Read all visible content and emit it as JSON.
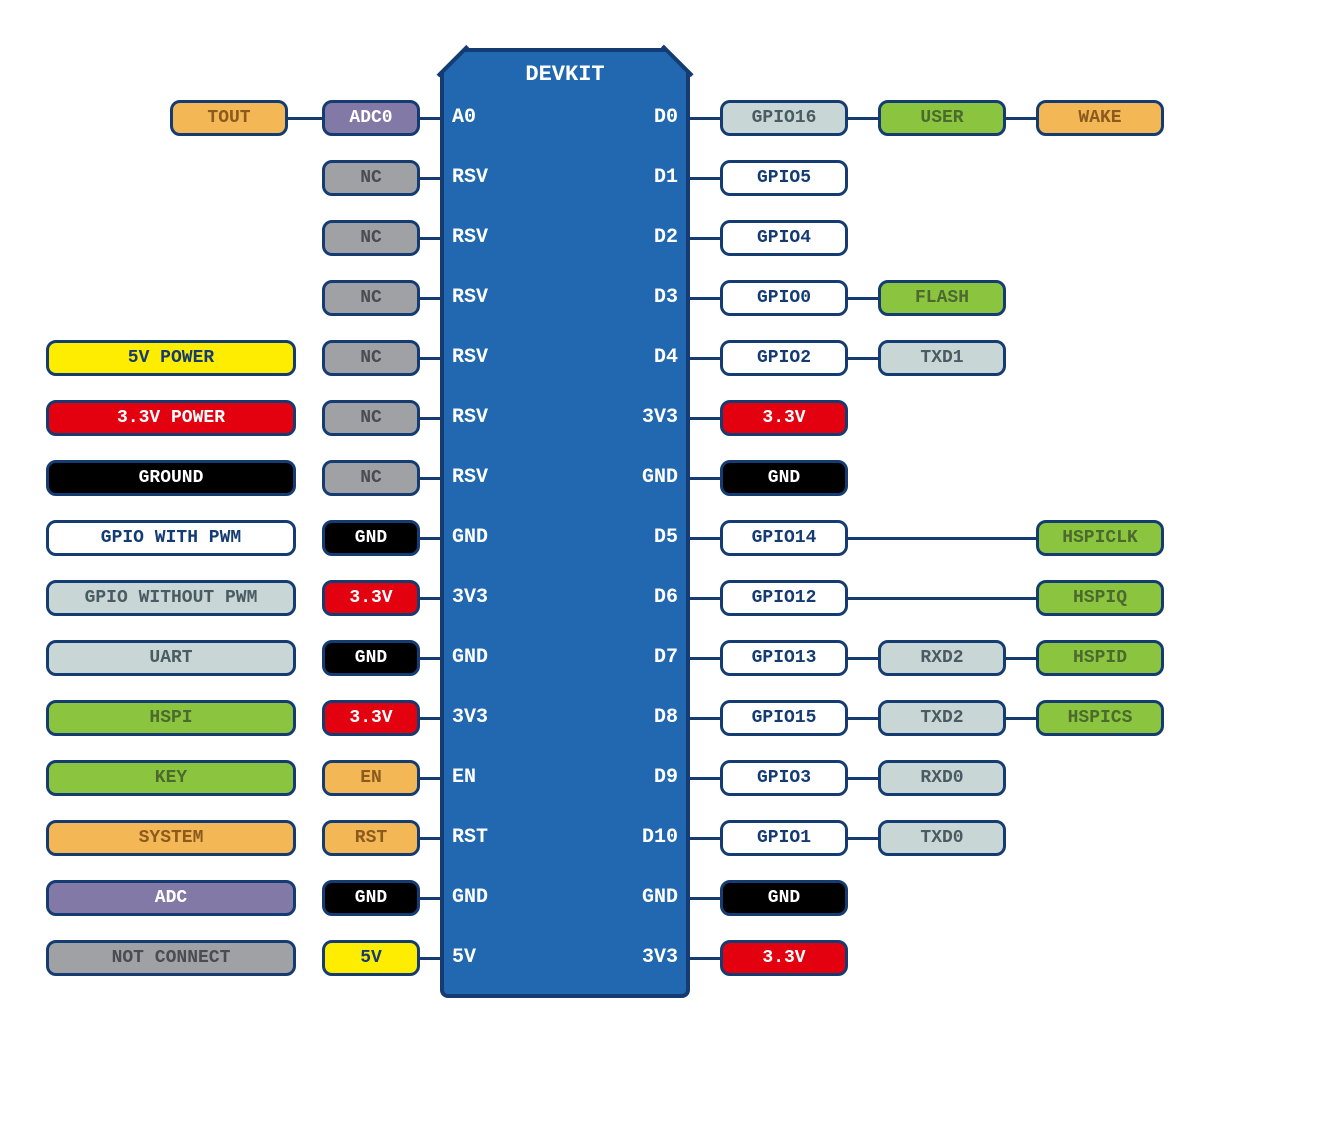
{
  "title": "DEVKIT",
  "colors": {
    "border": "#153c72",
    "module": "#2168b0",
    "pwr5v_bg": "#ffed00",
    "pwr5v_fg": "#153c72",
    "pwr3v3_bg": "#e3000f",
    "pwr3v3_fg": "#ffffff",
    "gnd_bg": "#000000",
    "gnd_fg": "#ffffff",
    "gpio_pwm_bg": "#ffffff",
    "gpio_pwm_fg": "#153c72",
    "gpio_nopwm_bg": "#c8d7d5",
    "gpio_nopwm_fg": "#4a5b63",
    "uart_bg": "#c8d7d5",
    "uart_fg": "#4a5b63",
    "hspi_bg": "#8bc53f",
    "hspi_fg": "#4c6a2e",
    "key_bg": "#8bc53f",
    "key_fg": "#4c6a2e",
    "system_bg": "#f4b755",
    "system_fg": "#8a5a1e",
    "adc_bg": "#8279a6",
    "adc_fg": "#ffffff",
    "nc_bg": "#9fa1a4",
    "nc_fg": "#4a4c51"
  },
  "legend": [
    {
      "label": "5V POWER",
      "kind": "pwr5v"
    },
    {
      "label": "3.3V POWER",
      "kind": "pwr3v3"
    },
    {
      "label": "GROUND",
      "kind": "gnd"
    },
    {
      "label": "GPIO WITH PWM",
      "kind": "gpio_pwm"
    },
    {
      "label": "GPIO WITHOUT PWM",
      "kind": "gpio_nopwm"
    },
    {
      "label": "UART",
      "kind": "uart"
    },
    {
      "label": "HSPI",
      "kind": "hspi"
    },
    {
      "label": "KEY",
      "kind": "key"
    },
    {
      "label": "SYSTEM",
      "kind": "system"
    },
    {
      "label": "ADC",
      "kind": "adc"
    },
    {
      "label": "NOT CONNECT",
      "kind": "nc"
    }
  ],
  "left_pins": [
    "A0",
    "RSV",
    "RSV",
    "RSV",
    "RSV",
    "RSV",
    "RSV",
    "GND",
    "3V3",
    "GND",
    "3V3",
    "EN",
    "RST",
    "GND",
    "5V"
  ],
  "right_pins": [
    "D0",
    "D1",
    "D2",
    "D3",
    "D4",
    "3V3",
    "GND",
    "D5",
    "D6",
    "D7",
    "D8",
    "D9",
    "D10",
    "GND",
    "3V3"
  ],
  "left_rows": [
    [
      null,
      {
        "label": "TOUT",
        "kind": "system"
      },
      {
        "label": "ADC0",
        "kind": "adc"
      }
    ],
    [
      null,
      null,
      {
        "label": "NC",
        "kind": "nc"
      }
    ],
    [
      null,
      null,
      {
        "label": "NC",
        "kind": "nc"
      }
    ],
    [
      null,
      null,
      {
        "label": "NC",
        "kind": "nc"
      }
    ],
    [
      null,
      null,
      {
        "label": "NC",
        "kind": "nc"
      }
    ],
    [
      null,
      null,
      {
        "label": "NC",
        "kind": "nc"
      }
    ],
    [
      null,
      null,
      {
        "label": "NC",
        "kind": "nc"
      }
    ],
    [
      null,
      null,
      {
        "label": "GND",
        "kind": "gnd"
      }
    ],
    [
      null,
      null,
      {
        "label": "3.3V",
        "kind": "pwr3v3"
      }
    ],
    [
      null,
      null,
      {
        "label": "GND",
        "kind": "gnd"
      }
    ],
    [
      null,
      null,
      {
        "label": "3.3V",
        "kind": "pwr3v3"
      }
    ],
    [
      null,
      null,
      {
        "label": "EN",
        "kind": "system"
      }
    ],
    [
      null,
      null,
      {
        "label": "RST",
        "kind": "system"
      }
    ],
    [
      null,
      null,
      {
        "label": "GND",
        "kind": "gnd"
      }
    ],
    [
      null,
      null,
      {
        "label": "5V",
        "kind": "pwr5v"
      }
    ]
  ],
  "right_rows": [
    [
      {
        "label": "GPIO16",
        "kind": "gpio_nopwm"
      },
      {
        "label": "USER",
        "kind": "key"
      },
      {
        "label": "WAKE",
        "kind": "system"
      }
    ],
    [
      {
        "label": "GPIO5",
        "kind": "gpio_pwm"
      },
      null,
      null
    ],
    [
      {
        "label": "GPIO4",
        "kind": "gpio_pwm"
      },
      null,
      null
    ],
    [
      {
        "label": "GPIO0",
        "kind": "gpio_pwm"
      },
      {
        "label": "FLASH",
        "kind": "key"
      },
      null
    ],
    [
      {
        "label": "GPIO2",
        "kind": "gpio_pwm"
      },
      {
        "label": "TXD1",
        "kind": "uart"
      },
      null
    ],
    [
      {
        "label": "3.3V",
        "kind": "pwr3v3"
      },
      null,
      null
    ],
    [
      {
        "label": "GND",
        "kind": "gnd"
      },
      null,
      null
    ],
    [
      {
        "label": "GPIO14",
        "kind": "gpio_pwm"
      },
      null,
      {
        "label": "HSPICLK",
        "kind": "hspi"
      }
    ],
    [
      {
        "label": "GPIO12",
        "kind": "gpio_pwm"
      },
      null,
      {
        "label": "HSPIQ",
        "kind": "hspi"
      }
    ],
    [
      {
        "label": "GPIO13",
        "kind": "gpio_pwm"
      },
      {
        "label": "RXD2",
        "kind": "uart"
      },
      {
        "label": "HSPID",
        "kind": "hspi"
      }
    ],
    [
      {
        "label": "GPIO15",
        "kind": "gpio_pwm"
      },
      {
        "label": "TXD2",
        "kind": "uart"
      },
      {
        "label": "HSPICS",
        "kind": "hspi"
      }
    ],
    [
      {
        "label": "GPIO3",
        "kind": "gpio_pwm"
      },
      {
        "label": "RXD0",
        "kind": "uart"
      },
      null
    ],
    [
      {
        "label": "GPIO1",
        "kind": "gpio_pwm"
      },
      {
        "label": "TXD0",
        "kind": "uart"
      },
      null
    ],
    [
      {
        "label": "GND",
        "kind": "gnd"
      },
      null,
      null
    ],
    [
      {
        "label": "3.3V",
        "kind": "pwr3v3"
      },
      null,
      null
    ]
  ]
}
